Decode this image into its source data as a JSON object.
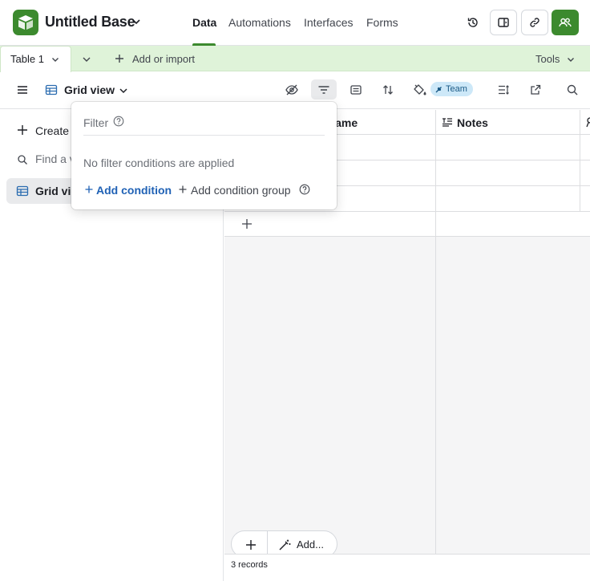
{
  "header": {
    "base_name": "Untitled Base",
    "tabs": [
      {
        "label": "Data",
        "active": true
      },
      {
        "label": "Automations"
      },
      {
        "label": "Interfaces"
      },
      {
        "label": "Forms"
      }
    ],
    "icons": [
      "history-icon",
      "launch-icon",
      "link-icon",
      "share-collaborators-icon"
    ]
  },
  "table_bar": {
    "active_table": "Table 1",
    "add_import_label": "Add or import",
    "tools_label": "Tools"
  },
  "view_bar": {
    "view_name": "Grid view",
    "team_badge": "Team"
  },
  "sidebar": {
    "create_label": "Create",
    "find_placeholder": "Find a view",
    "items": [
      {
        "label": "Grid view",
        "selected": true
      }
    ]
  },
  "grid": {
    "columns": [
      {
        "label": "Name",
        "icon": "primary-field-icon"
      },
      {
        "label": "Notes",
        "icon": "long-text-icon"
      }
    ],
    "record_count": "3 records",
    "bottom_add_label": "Add..."
  },
  "filter_popover": {
    "title": "Filter",
    "empty_message": "No filter conditions are applied",
    "add_condition_label": "Add condition",
    "add_group_label": "Add condition group"
  },
  "colors": {
    "brand_green": "#3c8a2e",
    "table_bar_bg": "#dff3d9",
    "link_blue": "#1f61b5",
    "team_badge_bg": "#cde8f8"
  }
}
